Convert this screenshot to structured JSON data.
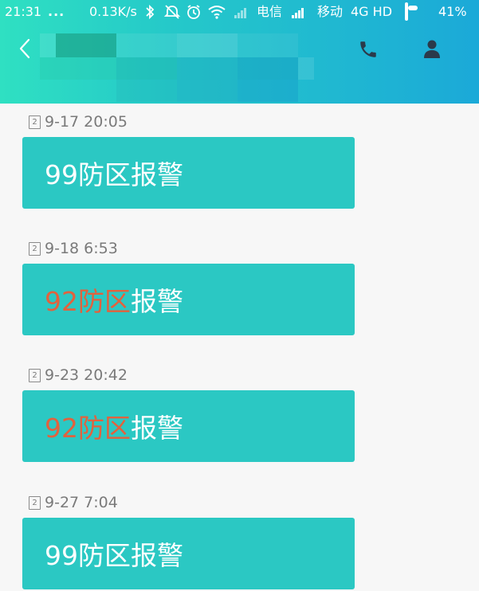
{
  "status_bar": {
    "time": "21:31",
    "dots": "...",
    "speed": "0.13K/s",
    "operator1": "电信",
    "operator2": "移动",
    "network": "4G HD",
    "battery_percent": "41%",
    "icons": [
      "bluetooth-icon",
      "mute-icon",
      "alarm-icon",
      "wifi-icon",
      "signal-icon",
      "battery-icon"
    ]
  },
  "nav": {
    "icons": [
      "back-icon",
      "phone-icon",
      "profile-icon"
    ]
  },
  "messages": [
    {
      "sim": "2",
      "time": "9-17 20:05",
      "zone": "99防区",
      "suffix": "报警",
      "highlight": false
    },
    {
      "sim": "2",
      "time": "9-18 6:53",
      "zone": "92防区",
      "suffix": "报警",
      "highlight": true
    },
    {
      "sim": "2",
      "time": "9-23 20:42",
      "zone": "92防区",
      "suffix": "报警",
      "highlight": true
    },
    {
      "sim": "2",
      "time": "9-27 7:04",
      "zone": "99防区",
      "suffix": "报警",
      "highlight": false
    }
  ],
  "colors": {
    "bubble": "#2bc8c3",
    "highlight_text": "#e2623d",
    "header_gradient_start": "#2fe0c2",
    "header_gradient_end": "#1ba9d8"
  }
}
